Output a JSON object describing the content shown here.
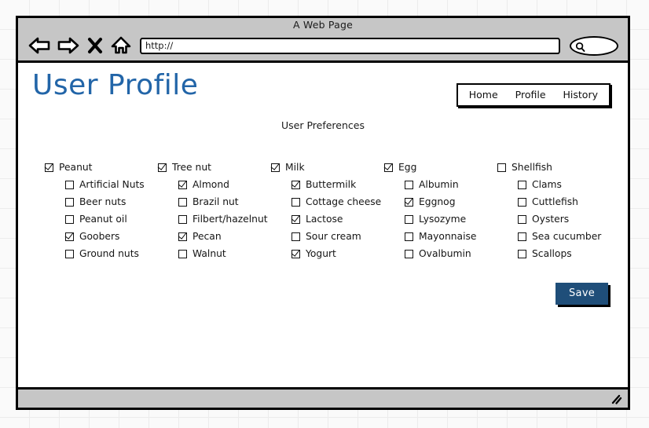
{
  "window": {
    "title": "A Web Page",
    "toolbar": {
      "back_icon": "back-arrow-icon",
      "forward_icon": "forward-arrow-icon",
      "stop_icon": "stop-x-icon",
      "home_icon": "home-icon",
      "url_value": "http://",
      "url_placeholder": "http://",
      "search_icon": "search-magnifier-icon",
      "search_value": ""
    },
    "status_bar": {
      "resize_icon": "resize-grip-icon"
    }
  },
  "page": {
    "title": "User Profile",
    "title_color": "#2265a8",
    "section_label": "User Preferences",
    "nav": {
      "items": [
        {
          "label": "Home"
        },
        {
          "label": "Profile"
        },
        {
          "label": "History"
        }
      ]
    },
    "save_button": {
      "label": "Save",
      "color": "#1f4e79"
    },
    "columns": [
      {
        "parent": {
          "label": "Peanut",
          "checked": true
        },
        "children": [
          {
            "label": "Artificial Nuts",
            "checked": false
          },
          {
            "label": "Beer nuts",
            "checked": false
          },
          {
            "label": "Peanut oil",
            "checked": false
          },
          {
            "label": "Goobers",
            "checked": true
          },
          {
            "label": "Ground nuts",
            "checked": false
          }
        ]
      },
      {
        "parent": {
          "label": "Tree nut",
          "checked": true
        },
        "children": [
          {
            "label": "Almond",
            "checked": true
          },
          {
            "label": "Brazil nut",
            "checked": false
          },
          {
            "label": "Filbert/hazelnut",
            "checked": false
          },
          {
            "label": "Pecan",
            "checked": true
          },
          {
            "label": "Walnut",
            "checked": false
          }
        ]
      },
      {
        "parent": {
          "label": "Milk",
          "checked": true
        },
        "children": [
          {
            "label": "Buttermilk",
            "checked": true
          },
          {
            "label": "Cottage cheese",
            "checked": false
          },
          {
            "label": "Lactose",
            "checked": true
          },
          {
            "label": "Sour cream",
            "checked": false
          },
          {
            "label": "Yogurt",
            "checked": true
          }
        ]
      },
      {
        "parent": {
          "label": "Egg",
          "checked": true
        },
        "children": [
          {
            "label": "Albumin",
            "checked": false
          },
          {
            "label": "Eggnog",
            "checked": true
          },
          {
            "label": "Lysozyme",
            "checked": false
          },
          {
            "label": "Mayonnaise",
            "checked": false
          },
          {
            "label": "Ovalbumin",
            "checked": false
          }
        ]
      },
      {
        "parent": {
          "label": "Shellfish",
          "checked": false
        },
        "children": [
          {
            "label": "Clams",
            "checked": false
          },
          {
            "label": "Cuttlefish",
            "checked": false
          },
          {
            "label": "Oysters",
            "checked": false
          },
          {
            "label": "Sea cucumber",
            "checked": false
          },
          {
            "label": "Scallops",
            "checked": false
          }
        ]
      }
    ]
  }
}
